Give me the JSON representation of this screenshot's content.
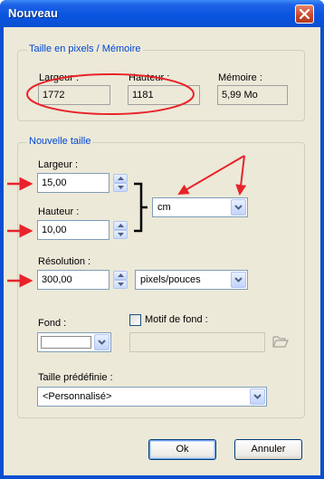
{
  "window": {
    "title": "Nouveau"
  },
  "pixel_group": {
    "legend": "Taille en pixels / Mémoire",
    "width_label": "Largeur :",
    "width_value": "1772",
    "height_label": "Hauteur :",
    "height_value": "1181",
    "memory_label": "Mémoire :",
    "memory_value": "5,99 Mo"
  },
  "new_size_group": {
    "legend": "Nouvelle taille",
    "width_label": "Largeur :",
    "width_value": "15,00",
    "height_label": "Hauteur :",
    "height_value": "10,00",
    "unit_selected": "cm",
    "resolution_label": "Résolution :",
    "resolution_value": "300,00",
    "resolution_unit_selected": "pixels/pouces",
    "background_label": "Fond :",
    "pattern_checkbox_label": "Motif de fond :",
    "pattern_checked": false,
    "preset_label": "Taille prédéfinie :",
    "preset_selected": "<Personnalisé>"
  },
  "buttons": {
    "ok": "Ok",
    "cancel": "Annuler"
  },
  "colors": {
    "annotation_red": "#e8232a",
    "title_blue": "#0a55e0",
    "legend_blue": "#0046d5",
    "dialog_face": "#ece9d8"
  },
  "icons": {
    "close": "close-x-icon",
    "spin_up": "arrow-up-icon",
    "spin_down": "arrow-down-icon",
    "dropdown": "chevron-down-icon",
    "browse": "open-folder-icon"
  }
}
